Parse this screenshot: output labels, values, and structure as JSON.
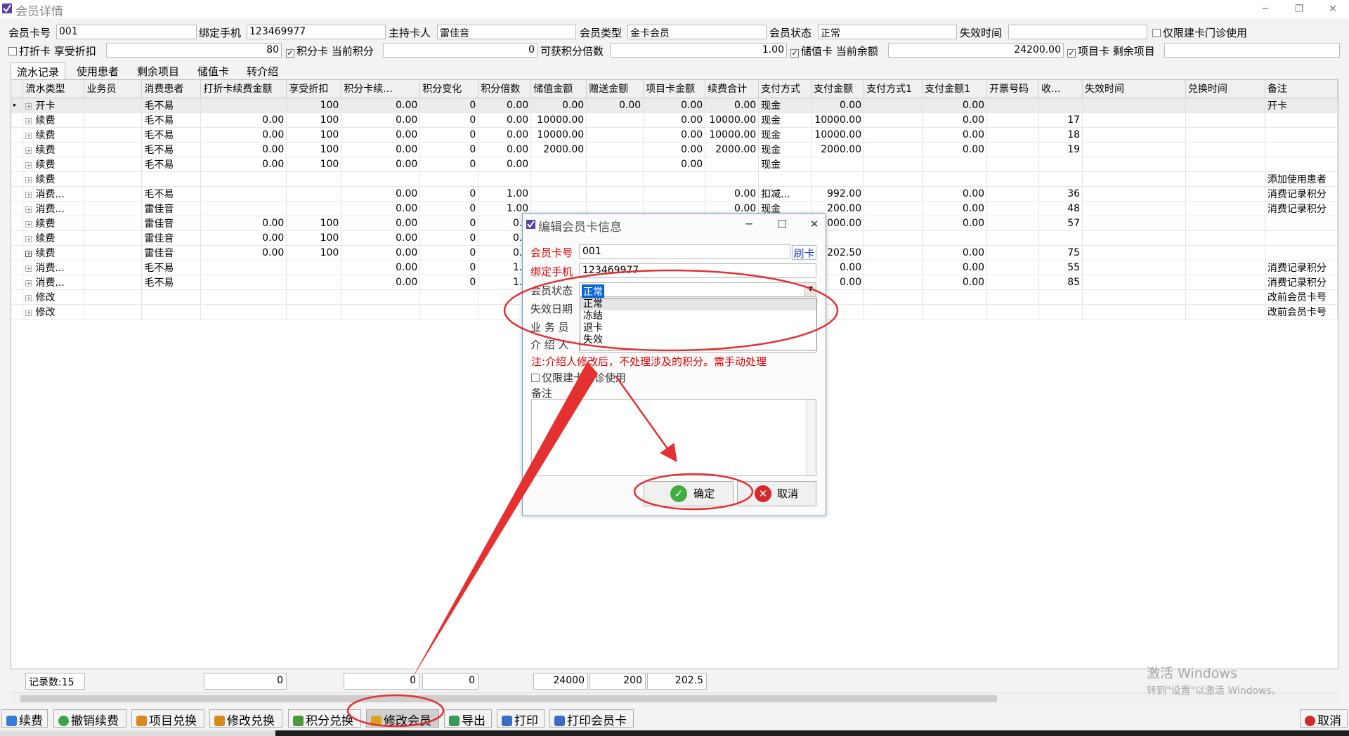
{
  "window": {
    "title": "会员详情",
    "minimize": "─",
    "restore": "❐",
    "close": "✕"
  },
  "member": {
    "card_no_label": "会员卡号",
    "card_no": "001",
    "phone_label": "绑定手机",
    "phone": "123469977",
    "holder_label": "主持卡人",
    "holder": "雷佳音",
    "type_label": "会员类型",
    "type": "金卡会员",
    "status_label": "会员状态",
    "status": "正常",
    "expire_label": "失效时间",
    "expire": "",
    "clinic_only_label": "仅限建卡门诊使用",
    "discount_card_label": "打折卡",
    "discount_label": "享受折扣",
    "discount": "80",
    "points_card_label": "积分卡",
    "points_label": "当前积分",
    "points": "0",
    "multiplier_label": "可获积分倍数",
    "multiplier": "1.00",
    "stored_card_label": "储值卡",
    "balance_label": "当前余额",
    "balance": "24200.00",
    "item_card_label": "项目卡",
    "remaining_label": "剩余项目",
    "remaining": ""
  },
  "tabs": [
    "流水记录",
    "使用患者",
    "剩余项目",
    "储值卡",
    "转介绍"
  ],
  "grid": {
    "headers": [
      "流水类型",
      "业务员",
      "消费患者",
      "打折卡续费金额",
      "享受折扣",
      "积分卡续...",
      "积分变化",
      "积分倍数",
      "储值金额",
      "赠送金额",
      "项目卡金额",
      "续费合计",
      "支付方式",
      "支付金额",
      "支付方式1",
      "支付金额1",
      "开票号码",
      "收...",
      "失效时间",
      "兑换时间",
      "备注"
    ],
    "rows": [
      [
        "开卡",
        "",
        "毛不易",
        "",
        "100",
        "0.00",
        "0",
        "0.00",
        "0.00",
        "0.00",
        "0.00",
        "0.00",
        "现金",
        "0.00",
        "",
        "0.00",
        "",
        "",
        "",
        "",
        "开卡"
      ],
      [
        "续费",
        "",
        "毛不易",
        "0.00",
        "100",
        "0.00",
        "0",
        "0.00",
        "10000.00",
        "",
        "0.00",
        "10000.00",
        "现金",
        "10000.00",
        "",
        "0.00",
        "",
        "17",
        "",
        "",
        ""
      ],
      [
        "续费",
        "",
        "毛不易",
        "0.00",
        "100",
        "0.00",
        "0",
        "0.00",
        "10000.00",
        "",
        "0.00",
        "10000.00",
        "现金",
        "10000.00",
        "",
        "0.00",
        "",
        "18",
        "",
        "",
        ""
      ],
      [
        "续费",
        "",
        "毛不易",
        "0.00",
        "100",
        "0.00",
        "0",
        "0.00",
        "2000.00",
        "",
        "0.00",
        "2000.00",
        "现金",
        "2000.00",
        "",
        "0.00",
        "",
        "19",
        "",
        "",
        ""
      ],
      [
        "续费",
        "",
        "毛不易",
        "0.00",
        "100",
        "0.00",
        "0",
        "0.00",
        "",
        "",
        "0.00",
        "",
        "现金",
        "",
        "",
        "",
        "",
        "",
        "",
        "",
        ""
      ],
      [
        "续费",
        "",
        "",
        "",
        "",
        "",
        "",
        "",
        "",
        "",
        "",
        "",
        "",
        "",
        "",
        "",
        "",
        "",
        "",
        "",
        "添加使用患者"
      ],
      [
        "消费...",
        "",
        "毛不易",
        "",
        "",
        "0.00",
        "0",
        "1.00",
        "",
        "",
        "",
        "0.00",
        "扣减...",
        "992.00",
        "",
        "0.00",
        "",
        "36",
        "",
        "",
        "消费记录积分"
      ],
      [
        "消费...",
        "",
        "雷佳音",
        "",
        "",
        "0.00",
        "0",
        "1.00",
        "",
        "",
        "",
        "0.00",
        "现金",
        "200.00",
        "",
        "0.00",
        "",
        "48",
        "",
        "",
        "消费记录积分"
      ],
      [
        "续费",
        "",
        "雷佳音",
        "0.00",
        "100",
        "0.00",
        "0",
        "0.0",
        "",
        "",
        "",
        "",
        "",
        "2000.00",
        "",
        "0.00",
        "",
        "57",
        "",
        "",
        ""
      ],
      [
        "续费",
        "",
        "雷佳音",
        "0.00",
        "100",
        "0.00",
        "0",
        "0.0",
        "",
        "",
        "",
        "",
        "",
        "",
        "",
        "",
        "",
        "",
        "",
        "",
        ""
      ],
      [
        "续费",
        "",
        "雷佳音",
        "0.00",
        "100",
        "0.00",
        "0",
        "0.0",
        "",
        "",
        "",
        "",
        "",
        "202.50",
        "",
        "0.00",
        "",
        "75",
        "",
        "",
        ""
      ],
      [
        "消费...",
        "",
        "毛不易",
        "",
        "",
        "0.00",
        "0",
        "1.0",
        "",
        "",
        "",
        "",
        "",
        "0.00",
        "",
        "0.00",
        "",
        "55",
        "",
        "",
        "消费记录积分"
      ],
      [
        "消费...",
        "",
        "毛不易",
        "",
        "",
        "0.00",
        "0",
        "1.0",
        "",
        "",
        "",
        "",
        "",
        "0.00",
        "",
        "0.00",
        "",
        "85",
        "",
        "",
        "消费记录积分"
      ],
      [
        "修改",
        "",
        "",
        "",
        "",
        "",
        "",
        "",
        "",
        "",
        "",
        "",
        "",
        "",
        "",
        "",
        "",
        "",
        "",
        "",
        "改前会员卡号"
      ],
      [
        "修改",
        "",
        "",
        "",
        "",
        "",
        "",
        "",
        "",
        "",
        "",
        "",
        "",
        "",
        "",
        "",
        "",
        "",
        "",
        "",
        "改前会员卡号"
      ]
    ],
    "expanded_row": 10
  },
  "footer": {
    "record_count": "记录数:15",
    "sum_discount": "0",
    "sum_points": "0",
    "sum_change": "0",
    "sum_stored": "24000",
    "sum_gift": "200",
    "sum_item": "202.5"
  },
  "toolbar": [
    "续费",
    "撤销续费",
    "项目兑换",
    "修改兑换",
    "积分兑换",
    "修改会员",
    "导出",
    "打印",
    "打印会员卡"
  ],
  "cancel_label": "取消",
  "activation": {
    "line1": "激活 Windows",
    "line2": "转到\"设置\"以激活 Windows。"
  },
  "dialog": {
    "title": "编辑会员卡信息",
    "card_no_label": "会员卡号",
    "card_no": "001",
    "swipe_label": "刷卡",
    "phone_label": "绑定手机",
    "phone": "123469977",
    "status_label": "会员状态",
    "status_value": "正常",
    "expire_label": "失效日期",
    "staff_label": "业 务 员",
    "referrer_label": "介 绍 人",
    "status_options": [
      "正常",
      "冻结",
      "退卡",
      "失效"
    ],
    "note": "注:介绍人修改后，不处理涉及的积分。需手动处理",
    "clinic_only_label": "仅限建卡门诊使用",
    "remark_label": "备注",
    "ok_label": "确定",
    "cancel_label": "取消"
  }
}
